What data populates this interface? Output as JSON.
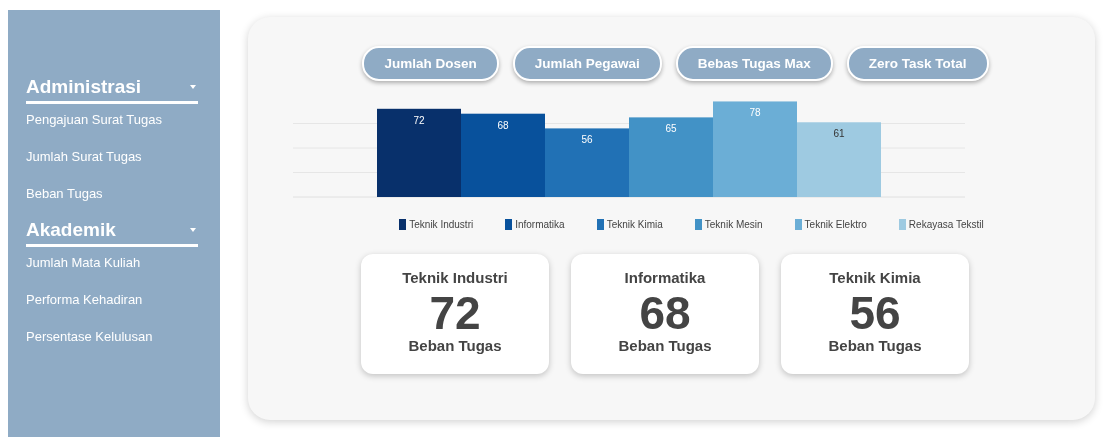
{
  "sidebar": {
    "sections": [
      {
        "title": "Administrasi",
        "expanded": true,
        "items": [
          "Pengajuan Surat Tugas",
          "Jumlah Surat Tugas",
          "Beban Tugas"
        ]
      },
      {
        "title": "Akademik",
        "expanded": true,
        "items": [
          "Jumlah Mata Kuliah",
          "Performa Kehadiran",
          "Persentase Kelulusan"
        ]
      }
    ]
  },
  "buttons": [
    "Jumlah Dosen",
    "Jumlah Pegawai",
    "Bebas Tugas Max",
    "Zero Task Total"
  ],
  "chart_data": {
    "type": "bar",
    "ylim": [
      0,
      80
    ],
    "data_labels": true,
    "series": [
      {
        "name": "Teknik Industri",
        "color": "#08306b",
        "values": [
          72
        ]
      },
      {
        "name": "Informatika",
        "color": "#08519c",
        "values": [
          68
        ]
      },
      {
        "name": "Teknik Kimia",
        "color": "#2171b5",
        "values": [
          56
        ]
      },
      {
        "name": "Teknik Mesin",
        "color": "#4292c6",
        "values": [
          65
        ]
      },
      {
        "name": "Teknik Elektro",
        "color": "#6baed6",
        "values": [
          78
        ]
      },
      {
        "name": "Rekayasa Tekstil",
        "color": "#9ecae1",
        "values": [
          61
        ]
      }
    ]
  },
  "cards": [
    {
      "title": "Teknik Industri",
      "value": "72",
      "caption": "Beban Tugas"
    },
    {
      "title": "Informatika",
      "value": "68",
      "caption": "Beban Tugas"
    },
    {
      "title": "Teknik Kimia",
      "value": "56",
      "caption": "Beban Tugas"
    }
  ]
}
